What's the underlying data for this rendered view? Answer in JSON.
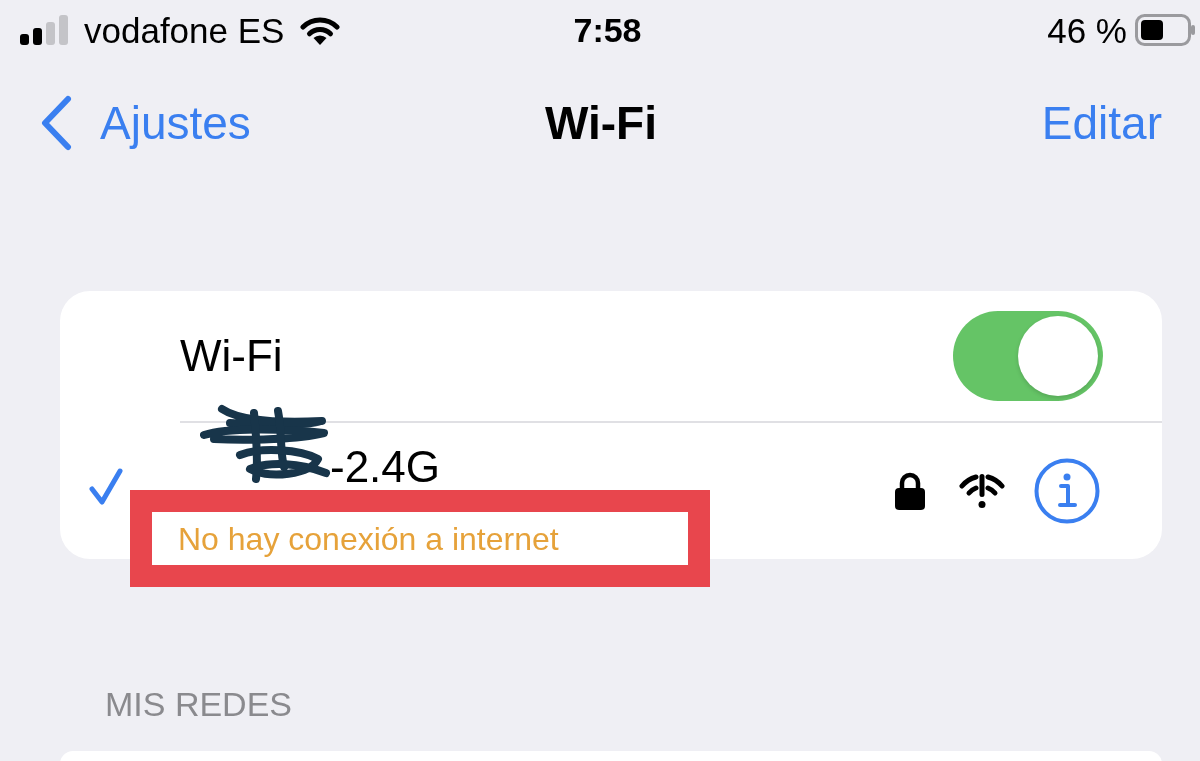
{
  "status_bar": {
    "carrier": "vodafone ES",
    "time": "7:58",
    "battery": "46 %"
  },
  "nav_bar": {
    "back": "Ajustes",
    "title": "Wi-Fi",
    "action": "Editar"
  },
  "wifi_toggle": {
    "label": "Wi-Fi",
    "on": true
  },
  "current_network": {
    "name": "-2.4G",
    "status": "No hay conexión a internet",
    "connected": true,
    "secured": true
  },
  "my_networks": {
    "header": "MIS REDES"
  }
}
